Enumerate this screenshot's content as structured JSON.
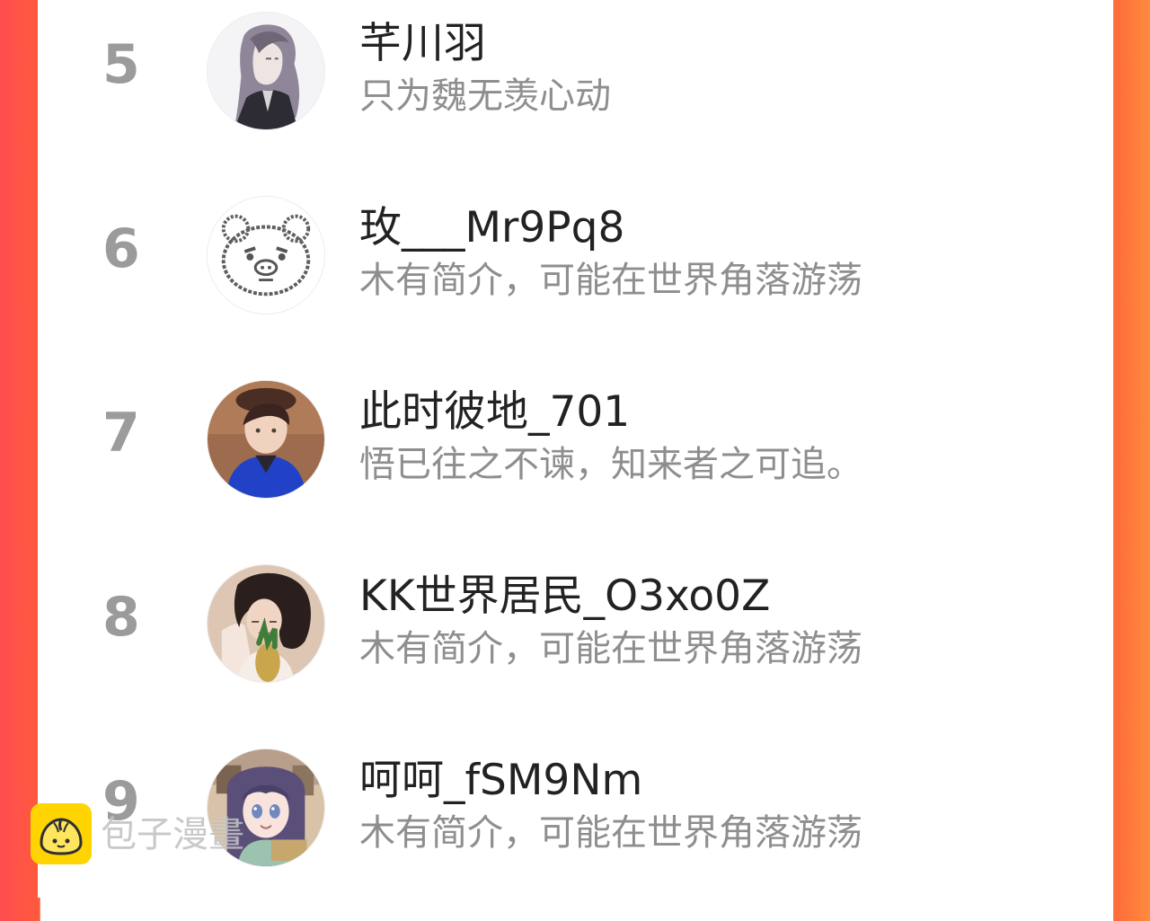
{
  "users": [
    {
      "rank": "5",
      "name": "芊川羽",
      "bio": "只为魏无羡心动",
      "avatar_icon": "anime-man-avatar"
    },
    {
      "rank": "6",
      "name": "玫___Mr9Pq8",
      "bio": "木有简介，可能在世界角落游荡",
      "avatar_icon": "bear-doodle-avatar"
    },
    {
      "rank": "7",
      "name": "此时彼地_701",
      "bio": "悟已往之不谏，知来者之可追。",
      "avatar_icon": "photo-boy-avatar"
    },
    {
      "rank": "8",
      "name": "KK世界居民_O3xo0Z",
      "bio": "木有简介，可能在世界角落游荡",
      "avatar_icon": "photo-girl-avatar"
    },
    {
      "rank": "9",
      "name": "呵呵_fSM9Nm",
      "bio": "木有简介，可能在世界角落游荡",
      "avatar_icon": "anime-girl-avatar"
    }
  ],
  "watermark": {
    "text": "包子漫畫",
    "icon": "bun-logo-icon"
  },
  "colors": {
    "left_edge": "#ff4d4f",
    "right_edge": "#ff7a3a",
    "rank": "#9b9b9b",
    "name": "#222222",
    "bio": "#8e8e8e",
    "watermark_icon": "#ffd400"
  }
}
